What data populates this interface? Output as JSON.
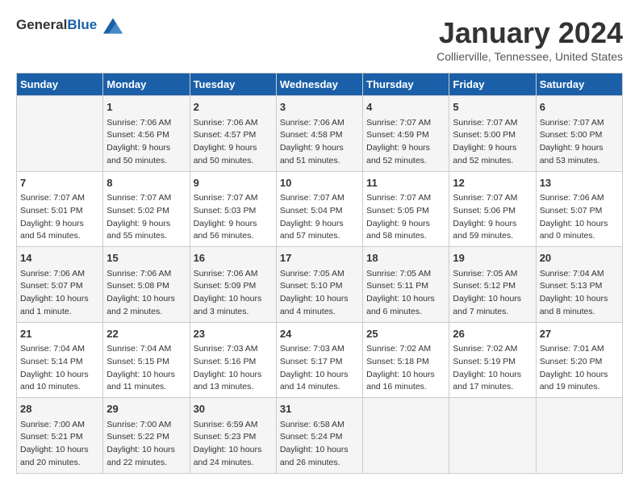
{
  "header": {
    "logo_general": "General",
    "logo_blue": "Blue",
    "month_title": "January 2024",
    "location": "Collierville, Tennessee, United States"
  },
  "days_of_week": [
    "Sunday",
    "Monday",
    "Tuesday",
    "Wednesday",
    "Thursday",
    "Friday",
    "Saturday"
  ],
  "weeks": [
    [
      {
        "day": "",
        "info": ""
      },
      {
        "day": "1",
        "info": "Sunrise: 7:06 AM\nSunset: 4:56 PM\nDaylight: 9 hours\nand 50 minutes."
      },
      {
        "day": "2",
        "info": "Sunrise: 7:06 AM\nSunset: 4:57 PM\nDaylight: 9 hours\nand 50 minutes."
      },
      {
        "day": "3",
        "info": "Sunrise: 7:06 AM\nSunset: 4:58 PM\nDaylight: 9 hours\nand 51 minutes."
      },
      {
        "day": "4",
        "info": "Sunrise: 7:07 AM\nSunset: 4:59 PM\nDaylight: 9 hours\nand 52 minutes."
      },
      {
        "day": "5",
        "info": "Sunrise: 7:07 AM\nSunset: 5:00 PM\nDaylight: 9 hours\nand 52 minutes."
      },
      {
        "day": "6",
        "info": "Sunrise: 7:07 AM\nSunset: 5:00 PM\nDaylight: 9 hours\nand 53 minutes."
      }
    ],
    [
      {
        "day": "7",
        "info": "Sunrise: 7:07 AM\nSunset: 5:01 PM\nDaylight: 9 hours\nand 54 minutes."
      },
      {
        "day": "8",
        "info": "Sunrise: 7:07 AM\nSunset: 5:02 PM\nDaylight: 9 hours\nand 55 minutes."
      },
      {
        "day": "9",
        "info": "Sunrise: 7:07 AM\nSunset: 5:03 PM\nDaylight: 9 hours\nand 56 minutes."
      },
      {
        "day": "10",
        "info": "Sunrise: 7:07 AM\nSunset: 5:04 PM\nDaylight: 9 hours\nand 57 minutes."
      },
      {
        "day": "11",
        "info": "Sunrise: 7:07 AM\nSunset: 5:05 PM\nDaylight: 9 hours\nand 58 minutes."
      },
      {
        "day": "12",
        "info": "Sunrise: 7:07 AM\nSunset: 5:06 PM\nDaylight: 9 hours\nand 59 minutes."
      },
      {
        "day": "13",
        "info": "Sunrise: 7:06 AM\nSunset: 5:07 PM\nDaylight: 10 hours\nand 0 minutes."
      }
    ],
    [
      {
        "day": "14",
        "info": "Sunrise: 7:06 AM\nSunset: 5:07 PM\nDaylight: 10 hours\nand 1 minute."
      },
      {
        "day": "15",
        "info": "Sunrise: 7:06 AM\nSunset: 5:08 PM\nDaylight: 10 hours\nand 2 minutes."
      },
      {
        "day": "16",
        "info": "Sunrise: 7:06 AM\nSunset: 5:09 PM\nDaylight: 10 hours\nand 3 minutes."
      },
      {
        "day": "17",
        "info": "Sunrise: 7:05 AM\nSunset: 5:10 PM\nDaylight: 10 hours\nand 4 minutes."
      },
      {
        "day": "18",
        "info": "Sunrise: 7:05 AM\nSunset: 5:11 PM\nDaylight: 10 hours\nand 6 minutes."
      },
      {
        "day": "19",
        "info": "Sunrise: 7:05 AM\nSunset: 5:12 PM\nDaylight: 10 hours\nand 7 minutes."
      },
      {
        "day": "20",
        "info": "Sunrise: 7:04 AM\nSunset: 5:13 PM\nDaylight: 10 hours\nand 8 minutes."
      }
    ],
    [
      {
        "day": "21",
        "info": "Sunrise: 7:04 AM\nSunset: 5:14 PM\nDaylight: 10 hours\nand 10 minutes."
      },
      {
        "day": "22",
        "info": "Sunrise: 7:04 AM\nSunset: 5:15 PM\nDaylight: 10 hours\nand 11 minutes."
      },
      {
        "day": "23",
        "info": "Sunrise: 7:03 AM\nSunset: 5:16 PM\nDaylight: 10 hours\nand 13 minutes."
      },
      {
        "day": "24",
        "info": "Sunrise: 7:03 AM\nSunset: 5:17 PM\nDaylight: 10 hours\nand 14 minutes."
      },
      {
        "day": "25",
        "info": "Sunrise: 7:02 AM\nSunset: 5:18 PM\nDaylight: 10 hours\nand 16 minutes."
      },
      {
        "day": "26",
        "info": "Sunrise: 7:02 AM\nSunset: 5:19 PM\nDaylight: 10 hours\nand 17 minutes."
      },
      {
        "day": "27",
        "info": "Sunrise: 7:01 AM\nSunset: 5:20 PM\nDaylight: 10 hours\nand 19 minutes."
      }
    ],
    [
      {
        "day": "28",
        "info": "Sunrise: 7:00 AM\nSunset: 5:21 PM\nDaylight: 10 hours\nand 20 minutes."
      },
      {
        "day": "29",
        "info": "Sunrise: 7:00 AM\nSunset: 5:22 PM\nDaylight: 10 hours\nand 22 minutes."
      },
      {
        "day": "30",
        "info": "Sunrise: 6:59 AM\nSunset: 5:23 PM\nDaylight: 10 hours\nand 24 minutes."
      },
      {
        "day": "31",
        "info": "Sunrise: 6:58 AM\nSunset: 5:24 PM\nDaylight: 10 hours\nand 26 minutes."
      },
      {
        "day": "",
        "info": ""
      },
      {
        "day": "",
        "info": ""
      },
      {
        "day": "",
        "info": ""
      }
    ]
  ]
}
